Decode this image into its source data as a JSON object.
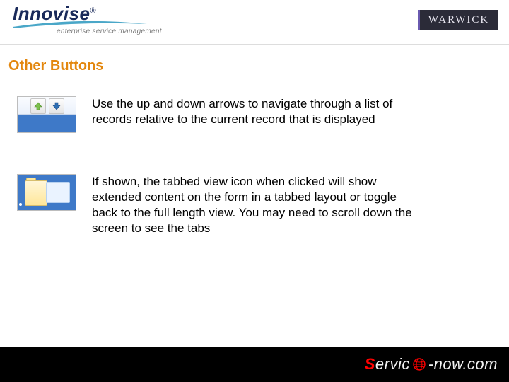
{
  "header": {
    "logo_text": "Innovise",
    "logo_tagline": "enterprise service management",
    "badge_label": "WARWICK"
  },
  "section_title": "Other Buttons",
  "rows": [
    {
      "description": "Use the up and down arrows  to navigate through a list of records relative to the current record that is displayed"
    },
    {
      "description": "If shown, the tabbed view icon  when clicked will show extended content on the form in a tabbed layout or toggle back to the full length view. You may need to scroll down the screen to see the tabs"
    }
  ],
  "footer": {
    "brand_initial": "S",
    "brand_rest": "ervice-now.com"
  }
}
